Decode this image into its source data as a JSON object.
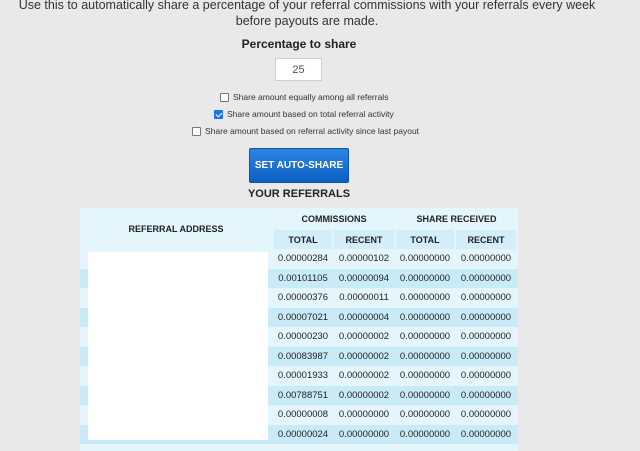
{
  "intro": "Use this to automatically share a percentage of your referral commissions with your referrals every week before payouts are made.",
  "percentage": {
    "title": "Percentage to share",
    "value": "25"
  },
  "options": [
    {
      "label": "Share amount equally among all referrals",
      "checked": false
    },
    {
      "label": "Share amount based on total referral activity",
      "checked": true
    },
    {
      "label": "Share amount based on referral activity since last payout",
      "checked": false
    }
  ],
  "button": {
    "label": "SET AUTO-SHARE"
  },
  "referrals": {
    "title": "YOUR REFERRALS",
    "headers": {
      "address": "REFERRAL ADDRESS",
      "commissions": "COMMISSIONS",
      "share_received": "SHARE RECEIVED",
      "total": "TOTAL",
      "recent": "RECENT"
    },
    "rows": [
      [
        "0.00000284",
        "0.00000102",
        "0.00000000",
        "0.00000000"
      ],
      [
        "0.00101105",
        "0.00000094",
        "0.00000000",
        "0.00000000"
      ],
      [
        "0.00000376",
        "0.00000011",
        "0.00000000",
        "0.00000000"
      ],
      [
        "0.00007021",
        "0.00000004",
        "0.00000000",
        "0.00000000"
      ],
      [
        "0.00000230",
        "0.00000002",
        "0.00000000",
        "0.00000000"
      ],
      [
        "0.00083987",
        "0.00000002",
        "0.00000000",
        "0.00000000"
      ],
      [
        "0.00001933",
        "0.00000002",
        "0.00000000",
        "0.00000000"
      ],
      [
        "0.00788751",
        "0.00000002",
        "0.00000000",
        "0.00000000"
      ],
      [
        "0.00000008",
        "0.00000000",
        "0.00000000",
        "0.00000000"
      ],
      [
        "0.00000024",
        "0.00000000",
        "0.00000000",
        "0.00000000"
      ]
    ]
  },
  "colors": {
    "accent": "#1a73e8",
    "button": "#1565c0",
    "table_bg": "#e4f5fb",
    "header_bg": "#d3eef9",
    "row_alt": "#c9ebf7"
  }
}
